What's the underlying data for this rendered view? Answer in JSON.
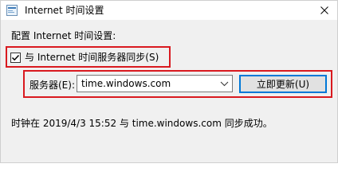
{
  "window": {
    "title": "Internet 时间设置",
    "close_icon": "close-icon",
    "app_icon": "internet-time-icon"
  },
  "content": {
    "intro": "配置 Internet 时间设置:",
    "sync_checkbox": {
      "label": "与 Internet 时间服务器同步(S)",
      "checked": true
    },
    "server": {
      "label": "服务器(E):",
      "value": "time.windows.com"
    },
    "update_button": "立即更新(U)",
    "status": "时钟在 2019/4/3 15:52 与 time.windows.com 同步成功。"
  },
  "colors": {
    "highlight": "#d9191f",
    "button_focus": "#0078d7",
    "background": "#f0f0f0"
  }
}
